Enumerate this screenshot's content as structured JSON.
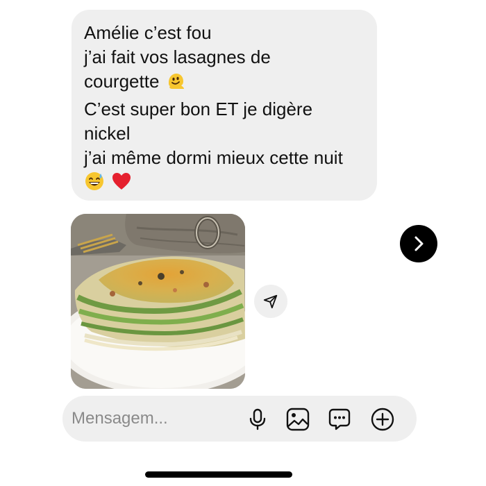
{
  "message": {
    "lines": [
      "Amélie c’est fou",
      "j’ai fait vos lasagnes de",
      "courgette",
      "C’est super bon ET je digère",
      "nickel",
      "j’ai même dormi mieux cette nuit"
    ],
    "emojis": [
      "melting-face",
      "grinning-sweat-face",
      "red-heart"
    ]
  },
  "attachment": {
    "type": "photo",
    "subject": "zucchini lasagna on a plate"
  },
  "composer": {
    "placeholder": "Mensagem...",
    "value": "",
    "icons": [
      "microphone-icon",
      "image-icon",
      "message-bubble-icon",
      "plus-circle-icon"
    ]
  },
  "colors": {
    "bubble": "#efefef",
    "text": "#111111",
    "placeholder": "#8a8a8a",
    "next_button": "#000000"
  }
}
